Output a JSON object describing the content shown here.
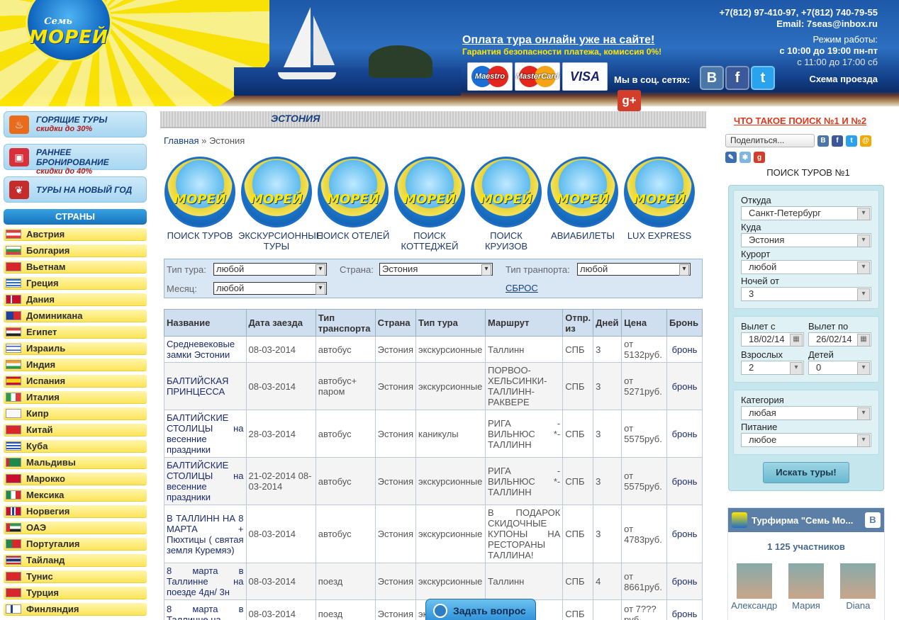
{
  "header": {
    "logo_line1": "Семь",
    "logo_line2": "МОРЕЙ",
    "payment_title": "Оплата тура онлайн уже на сайте!",
    "payment_sub": "Гарантия безопасности платежа, комиссия 0%!",
    "cards": [
      "Maestro",
      "MasterCard",
      "VISA"
    ],
    "social_label": "Мы в соц. сетях:",
    "phone_line1": "+7(812) 97-410-97, +7(812) 740-79-55",
    "email_line": "Email: 7seas@inbox.ru",
    "hours_label": "Режим работы:",
    "hours_weekdays": "с 10:00 до 19:00 пн-пт",
    "hours_saturday": "с 11:00 до 17:00 сб",
    "route_link": "Схема проезда"
  },
  "left": {
    "promos": [
      {
        "title": "ГОРЯЩИЕ ТУРЫ",
        "sub": "скидки до 30%"
      },
      {
        "title": "РАННЕЕ БРОНИРОВАНИЕ",
        "sub": "скидки до 40%"
      },
      {
        "title": "ТУРЫ НА НОВЫЙ ГОД",
        "sub": ""
      }
    ],
    "countries_header": "СТРАНЫ",
    "countries": [
      "Австрия",
      "Болгария",
      "Вьетнам",
      "Греция",
      "Дания",
      "Доминикана",
      "Египет",
      "Израиль",
      "Индия",
      "Испания",
      "Италия",
      "Кипр",
      "Китай",
      "Куба",
      "Мальдивы",
      "Марокко",
      "Мексика",
      "Норвегия",
      "ОАЭ",
      "Португалия",
      "Тайланд",
      "Тунис",
      "Турция",
      "Финляндия"
    ]
  },
  "main": {
    "page_title": "ЭСТОНИЯ",
    "breadcrumb_home": "Главная",
    "breadcrumb_sep": " » ",
    "breadcrumb_current": "Эстония",
    "categories": [
      "ПОИСК ТУРОВ",
      "ЭКСКУРСИОННЫЕ ТУРЫ",
      "ПОИСК ОТЕЛЕЙ",
      "ПОИСК КОТТЕДЖЕЙ",
      "ПОИСК КРУИЗОВ",
      "АВИАБИЛЕТЫ",
      "LUX EXPRESS"
    ],
    "filter": {
      "tour_type_label": "Тип тура:",
      "tour_type_value": "любой",
      "country_label": "Страна:",
      "country_value": "Эстония",
      "transport_label": "Тип транпорта:",
      "transport_value": "любой",
      "month_label": "Месяц:",
      "month_value": "любой",
      "reset": "СБРОС"
    },
    "table_headers": [
      "Название",
      "Дата заезда",
      "Тип транспорта",
      "Страна",
      "Тип тура",
      "Маршрут",
      "Отпр. из",
      "Дней",
      "Цена",
      "Бронь"
    ],
    "rows": [
      [
        "Средневековые замки Эстонии",
        "08-03-2014",
        "автобус",
        "Эстония",
        "экскурсионные",
        "Таллинн",
        "СПБ",
        "3",
        "от 5132руб.",
        "бронь"
      ],
      [
        "БАЛТИЙСКАЯ ПРИНЦЕССА",
        "08-03-2014",
        "автобус+ паром",
        "Эстония",
        "экскурсионные",
        "ПОРВОО-ХЕЛЬСИНКИ-ТАЛЛИНН-РАКВЕРЕ",
        "СПБ",
        "3",
        "от 5271руб.",
        "бронь"
      ],
      [
        "БАЛТИЙСКИЕ СТОЛИЦЫ на весенние праздники",
        "28-03-2014",
        "автобус",
        "Эстония",
        "каникулы",
        "РИГА - ВИЛЬНЮС *- ТАЛЛИНН",
        "СПБ",
        "3",
        "от 5575руб.",
        "бронь"
      ],
      [
        "БАЛТИЙСКИЕ СТОЛИЦЫ на весенние праздники",
        "21-02-2014 08-03-2014",
        "автобус",
        "Эстония",
        "экскурсионные",
        "РИГА - ВИЛЬНЮС *- ТАЛЛИНН",
        "СПБ",
        "3",
        "от 5575руб.",
        "бронь"
      ],
      [
        "В ТАЛЛИНН НА 8 МАРТА + Пюхтицы ( святая земля Куремяэ)",
        "08-03-2014",
        "автобус",
        "Эстония",
        "экскурсионные",
        "В ПОДАРОК СКИДОЧНЫЕ КУПОНЫ НА РЕСТОРАНЫ ТАЛЛИНА!",
        "СПБ",
        "3",
        "от 4783руб.",
        "бронь"
      ],
      [
        "8 марта в Таллинне на поезде 4дн/ 3н",
        "08-03-2014",
        "поезд",
        "Эстония",
        "экскурсионные",
        "Таллинн",
        "СПБ",
        "4",
        "от 8661руб.",
        "бронь"
      ],
      [
        "8 марта в Таллинне на",
        "08-03-2014",
        "поезд",
        "Эстония",
        "экскурсионные",
        "",
        "СПБ",
        "",
        "от 7???руб.",
        "бронь"
      ]
    ],
    "ask_button": "Задать вопрос"
  },
  "right": {
    "whatis": "ЧТО ТАКОЕ ПОИСК №1 И №2",
    "share": "Поделиться...",
    "search_title": "ПОИСК ТУРОВ №1",
    "from_label": "Откуда",
    "from_value": "Санкт-Петербург",
    "to_label": "Куда",
    "to_value": "Эстония",
    "resort_label": "Курорт",
    "resort_value": "любой",
    "nights_label": "Ночей от",
    "nights_value": "3",
    "dep_from_label": "Вылет с",
    "dep_from_value": "18/02/14",
    "dep_to_label": "Вылет по",
    "dep_to_value": "26/02/14",
    "adults_label": "Взрослых",
    "adults_value": "2",
    "kids_label": "Детей",
    "kids_value": "0",
    "category_label": "Категория",
    "category_value": "любая",
    "food_label": "Питание",
    "food_value": "любое",
    "search_button": "Искать туры!",
    "vk_title": "Турфирма \"Семь Мо...",
    "vk_members": "1 125 участников",
    "vk_people": [
      "Александр",
      "Мария",
      "Diana"
    ]
  },
  "colors": {
    "accent": "#1772bd",
    "promo_sub": "#b01b1b",
    "whatis": "#e0381b"
  }
}
